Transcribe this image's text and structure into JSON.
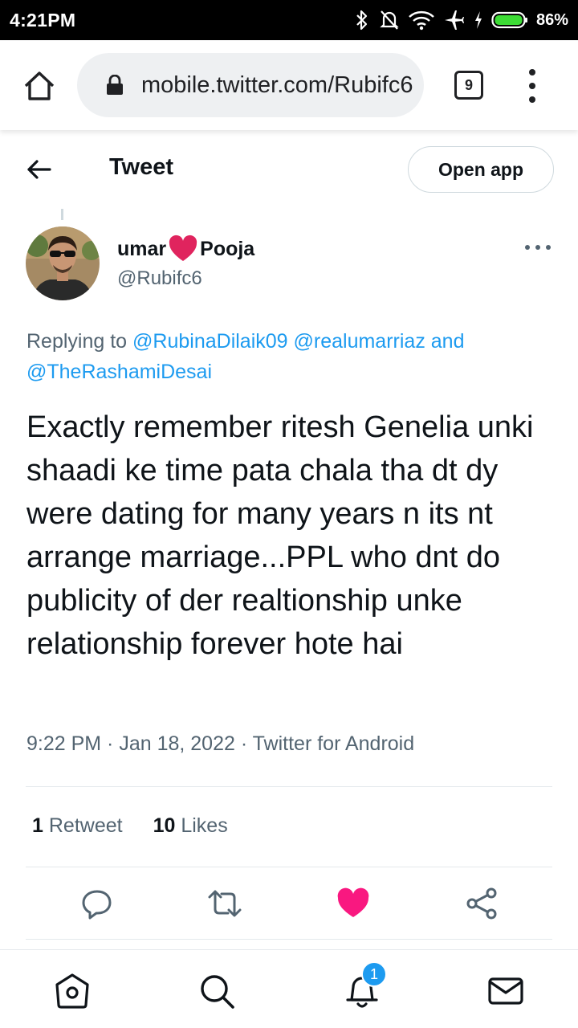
{
  "status_bar": {
    "time": "4:21PM",
    "battery_percent": "86%",
    "icons": [
      "bluetooth-icon",
      "mute-icon",
      "wifi-icon",
      "airplane-icon",
      "charging-icon",
      "battery-icon"
    ]
  },
  "browser": {
    "url": "mobile.twitter.com/Rubifc6",
    "tab_count": "9"
  },
  "header": {
    "title": "Tweet",
    "open_app_label": "Open app"
  },
  "tweet": {
    "author_name_first": "umar",
    "author_name_second": "Pooja",
    "author_handle": "@Rubifc6",
    "replying_prefix": "Replying to",
    "replying_mention_1": "@RubinaDilaik09",
    "replying_mention_2": "@realumarriaz",
    "replying_and": "and",
    "replying_mention_3": "@TheRashamiDesai",
    "text": "Exactly remember ritesh Genelia unki shaadi ke time pata chala tha dt dy were dating for many years n its nt arrange marriage...PPL who dnt do publicity of der realtionship unke relationship forever hote hai",
    "meta": "9:22 PM · Jan 18, 2022 · Twitter for Android",
    "retweet_count": "1",
    "retweet_label": "Retweet",
    "like_count": "10",
    "like_label": "Likes"
  },
  "actions": [
    "reply-icon",
    "retweet-icon",
    "like-icon",
    "share-icon"
  ],
  "bottom_nav": {
    "notification_badge": "1",
    "items": [
      "home-icon",
      "search-icon",
      "notifications-icon",
      "messages-icon"
    ]
  },
  "colors": {
    "link": "#1d9bf0",
    "like_active": "#f91880",
    "heart_emoji": "#e0245e",
    "secondary_text": "#536471"
  }
}
